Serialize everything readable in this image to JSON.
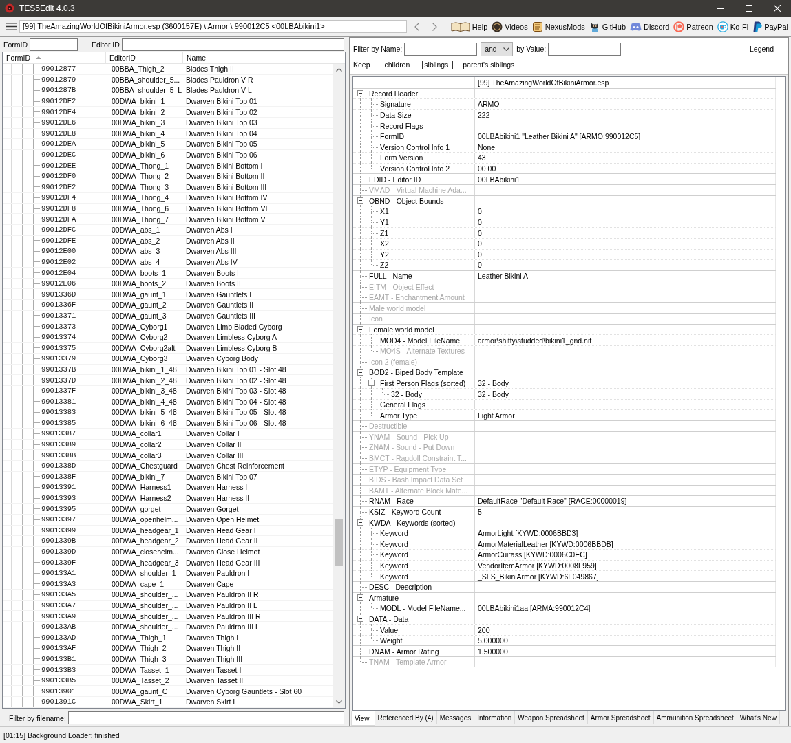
{
  "window": {
    "title": "TES5Edit 4.0.3"
  },
  "toolbar": {
    "path": "[99] TheAmazingWorldOfBikiniArmor.esp (3600157E) \\ Armor \\ 990012C5 <00LBAbikini1>",
    "links": [
      {
        "label": "Help",
        "kind": "help"
      },
      {
        "label": "Videos",
        "kind": "videos"
      },
      {
        "label": "NexusMods",
        "kind": "nexusmods"
      },
      {
        "label": "GitHub",
        "kind": "github"
      },
      {
        "label": "Discord",
        "kind": "discord"
      },
      {
        "label": "Patreon",
        "kind": "patreon"
      },
      {
        "label": "Ko-Fi",
        "kind": "kofi"
      },
      {
        "label": "PayPal",
        "kind": "paypal"
      }
    ]
  },
  "left_panel": {
    "formid_label": "FormID",
    "editorid_label": "Editor ID",
    "table": {
      "columns": [
        {
          "label": "FormID",
          "sorted": true
        },
        {
          "label": "EditorID",
          "sorted": false
        },
        {
          "label": "Name",
          "sorted": false
        }
      ],
      "rows": [
        {
          "form_id": "99012877",
          "editor_id": "00BBA_Thigh_2",
          "name": "Blades Thigh II"
        },
        {
          "form_id": "99012879",
          "editor_id": "00BBA_shoulder_5...",
          "name": "Blades Pauldron V R"
        },
        {
          "form_id": "9901287B",
          "editor_id": "00BBA_shoulder_5_L",
          "name": "Blades Pauldron V L"
        },
        {
          "form_id": "99012DE2",
          "editor_id": "00DWA_bikini_1",
          "name": "Dwarven Bikini Top 01"
        },
        {
          "form_id": "99012DE4",
          "editor_id": "00DWA_bikini_2",
          "name": "Dwarven Bikini Top 02"
        },
        {
          "form_id": "99012DE6",
          "editor_id": "00DWA_bikini_3",
          "name": "Dwarven Bikini Top 03"
        },
        {
          "form_id": "99012DE8",
          "editor_id": "00DWA_bikini_4",
          "name": "Dwarven Bikini Top 04"
        },
        {
          "form_id": "99012DEA",
          "editor_id": "00DWA_bikini_5",
          "name": "Dwarven Bikini Top 05"
        },
        {
          "form_id": "99012DEC",
          "editor_id": "00DWA_bikini_6",
          "name": "Dwarven Bikini Top 06"
        },
        {
          "form_id": "99012DEE",
          "editor_id": "00DWA_Thong_1",
          "name": "Dwarven Bikini Bottom I"
        },
        {
          "form_id": "99012DF0",
          "editor_id": "00DWA_Thong_2",
          "name": "Dwarven Bikini Bottom II"
        },
        {
          "form_id": "99012DF2",
          "editor_id": "00DWA_Thong_3",
          "name": "Dwarven Bikini Bottom III"
        },
        {
          "form_id": "99012DF4",
          "editor_id": "00DWA_Thong_4",
          "name": "Dwarven Bikini Bottom IV"
        },
        {
          "form_id": "99012DF8",
          "editor_id": "00DWA_Thong_6",
          "name": "Dwarven Bikini Bottom VI"
        },
        {
          "form_id": "99012DFA",
          "editor_id": "00DWA_Thong_7",
          "name": "Dwarven Bikini Bottom V"
        },
        {
          "form_id": "99012DFC",
          "editor_id": "00DWA_abs_1",
          "name": "Dwarven Abs I"
        },
        {
          "form_id": "99012DFE",
          "editor_id": "00DWA_abs_2",
          "name": "Dwarven Abs II"
        },
        {
          "form_id": "99012E00",
          "editor_id": "00DWA_abs_3",
          "name": "Dwarven Abs III"
        },
        {
          "form_id": "99012E02",
          "editor_id": "00DWA_abs_4",
          "name": "Dwarven Abs IV"
        },
        {
          "form_id": "99012E04",
          "editor_id": "00DWA_boots_1",
          "name": "Dwarven Boots I"
        },
        {
          "form_id": "99012E06",
          "editor_id": "00DWA_boots_2",
          "name": "Dwarven Boots II"
        },
        {
          "form_id": "9901336D",
          "editor_id": "00DWA_gaunt_1",
          "name": "Dwarven Gauntlets I"
        },
        {
          "form_id": "9901336F",
          "editor_id": "00DWA_gaunt_2",
          "name": "Dwarven Gauntlets II"
        },
        {
          "form_id": "99013371",
          "editor_id": "00DWA_gaunt_3",
          "name": "Dwarven Gauntlets III"
        },
        {
          "form_id": "99013373",
          "editor_id": "00DWA_Cyborg1",
          "name": "Dwarven Limb Bladed Cyborg"
        },
        {
          "form_id": "99013374",
          "editor_id": "00DWA_Cyborg2",
          "name": "Dwarven Limbless Cyborg A"
        },
        {
          "form_id": "99013375",
          "editor_id": "00DWA_Cyborg2alt",
          "name": "Dwarven Limbless Cyborg B"
        },
        {
          "form_id": "99013379",
          "editor_id": "00DWA_Cyborg3",
          "name": "Dwarven Cyborg Body"
        },
        {
          "form_id": "9901337B",
          "editor_id": "00DWA_bikini_1_48",
          "name": "Dwarven Bikini Top 01 - Slot 48"
        },
        {
          "form_id": "9901337D",
          "editor_id": "00DWA_bikini_2_48",
          "name": "Dwarven Bikini Top 02 - Slot 48"
        },
        {
          "form_id": "9901337F",
          "editor_id": "00DWA_bikini_3_48",
          "name": "Dwarven Bikini Top 03 - Slot 48"
        },
        {
          "form_id": "99013381",
          "editor_id": "00DWA_bikini_4_48",
          "name": "Dwarven Bikini Top 04 - Slot 48"
        },
        {
          "form_id": "99013383",
          "editor_id": "00DWA_bikini_5_48",
          "name": "Dwarven Bikini Top 05 - Slot 48"
        },
        {
          "form_id": "99013385",
          "editor_id": "00DWA_bikini_6_48",
          "name": "Dwarven Bikini Top 06 - Slot 48"
        },
        {
          "form_id": "99013387",
          "editor_id": "00DWA_collar1",
          "name": "Dwarven Collar I"
        },
        {
          "form_id": "99013389",
          "editor_id": "00DWA_collar2",
          "name": "Dwarven Collar II"
        },
        {
          "form_id": "9901338B",
          "editor_id": "00DWA_collar3",
          "name": "Dwarven Collar III"
        },
        {
          "form_id": "9901338D",
          "editor_id": "00DWA_Chestguard",
          "name": "Dwarven Chest Reinforcement"
        },
        {
          "form_id": "9901338F",
          "editor_id": "00DWA_bikini_7",
          "name": "Dwarven Bikini Top 07"
        },
        {
          "form_id": "99013391",
          "editor_id": "00DWA_Harness1",
          "name": "Dwarven Harness I"
        },
        {
          "form_id": "99013393",
          "editor_id": "00DWA_Harness2",
          "name": "Dwarven Harness II"
        },
        {
          "form_id": "99013395",
          "editor_id": "00DWA_gorget",
          "name": "Dwarven Gorget"
        },
        {
          "form_id": "99013397",
          "editor_id": "00DWA_openhelm...",
          "name": "Dwarven Open Helmet"
        },
        {
          "form_id": "99013399",
          "editor_id": "00DWA_headgear_1",
          "name": "Dwarven Head Gear I"
        },
        {
          "form_id": "9901339B",
          "editor_id": "00DWA_headgear_2",
          "name": "Dwarven Head Gear II"
        },
        {
          "form_id": "9901339D",
          "editor_id": "00DWA_closehelm...",
          "name": "Dwarven Close Helmet"
        },
        {
          "form_id": "9901339F",
          "editor_id": "00DWA_headgear_3",
          "name": "Dwarven Head Gear III"
        },
        {
          "form_id": "990133A1",
          "editor_id": "00DWA_shoulder_1",
          "name": "Dwarven Pauldron I"
        },
        {
          "form_id": "990133A3",
          "editor_id": "00DWA_cape_1",
          "name": "Dwarven Cape"
        },
        {
          "form_id": "990133A5",
          "editor_id": "00DWA_shoulder_...",
          "name": "Dwarven Pauldron II R"
        },
        {
          "form_id": "990133A7",
          "editor_id": "00DWA_shoulder_...",
          "name": "Dwarven Pauldron II L"
        },
        {
          "form_id": "990133A9",
          "editor_id": "00DWA_shoulder_...",
          "name": "Dwarven Pauldron III R"
        },
        {
          "form_id": "990133AB",
          "editor_id": "00DWA_shoulder_...",
          "name": "Dwarven Pauldron III L"
        },
        {
          "form_id": "990133AD",
          "editor_id": "00DWA_Thigh_1",
          "name": "Dwarven Thigh I"
        },
        {
          "form_id": "990133AF",
          "editor_id": "00DWA_Thigh_2",
          "name": "Dwarven Thigh II"
        },
        {
          "form_id": "990133B1",
          "editor_id": "00DWA_Thigh_3",
          "name": "Dwarven Thigh III"
        },
        {
          "form_id": "990133B3",
          "editor_id": "00DWA_Tasset_1",
          "name": "Dwarven Tasset I"
        },
        {
          "form_id": "990133B5",
          "editor_id": "00DWA_Tasset_2",
          "name": "Dwarven Tasset II"
        },
        {
          "form_id": "99013901",
          "editor_id": "00DWA_gaunt_C",
          "name": "Dwarven Cyborg Gauntlets - Slot 60"
        },
        {
          "form_id": "9901391C",
          "editor_id": "00DWA_Skirt_1",
          "name": "Dwarven Skirt I"
        }
      ]
    },
    "filename_label": "Filter by filename:"
  },
  "right_panel": {
    "filter": {
      "name_label": "Filter by Name:",
      "operator": "and",
      "value_label": "by Value:",
      "legend": "Legend"
    },
    "keep": {
      "label": "Keep",
      "options": [
        {
          "label": "children",
          "checked": false
        },
        {
          "label": "siblings",
          "checked": false
        },
        {
          "label": "parent's siblings",
          "checked": false
        }
      ]
    },
    "record_view": {
      "file_column": "[99] TheAmazingWorldOfBikiniArmor.esp",
      "fields": [
        {
          "label": "Record Header",
          "disabled": false,
          "expanded": true,
          "children": [
            {
              "label": "Signature",
              "value": "ARMO",
              "disabled": false
            },
            {
              "label": "Data Size",
              "value": "222",
              "disabled": false
            },
            {
              "label": "Record Flags",
              "disabled": false
            },
            {
              "label": "FormID",
              "value": "00LBAbikini1 \"Leather Bikini A\" [ARMO:990012C5]",
              "disabled": false
            },
            {
              "label": "Version Control Info 1",
              "value": "None",
              "disabled": false
            },
            {
              "label": "Form Version",
              "value": "43",
              "disabled": false
            },
            {
              "label": "Version Control Info 2",
              "value": "00 00",
              "disabled": false
            }
          ]
        },
        {
          "label": "EDID - Editor ID",
          "value": "00LBAbikini1",
          "disabled": false
        },
        {
          "label": "VMAD - Virtual Machine Ada...",
          "disabled": true
        },
        {
          "label": "OBND - Object Bounds",
          "disabled": false,
          "expanded": true,
          "children": [
            {
              "label": "X1",
              "value": "0",
              "disabled": false
            },
            {
              "label": "Y1",
              "value": "0",
              "disabled": false
            },
            {
              "label": "Z1",
              "value": "0",
              "disabled": false
            },
            {
              "label": "X2",
              "value": "0",
              "disabled": false
            },
            {
              "label": "Y2",
              "value": "0",
              "disabled": false
            },
            {
              "label": "Z2",
              "value": "0",
              "disabled": false
            }
          ]
        },
        {
          "label": "FULL - Name",
          "value": "Leather Bikini A",
          "disabled": false
        },
        {
          "label": "EITM - Object Effect",
          "disabled": true
        },
        {
          "label": "EAMT - Enchantment Amount",
          "disabled": true
        },
        {
          "label": "Male world model",
          "disabled": true
        },
        {
          "label": "Icon",
          "disabled": true
        },
        {
          "label": "Female world model",
          "disabled": false,
          "expanded": true,
          "children": [
            {
              "label": "MOD4 - Model FileName",
              "value": "armor\\shitty\\studded\\bikini1_gnd.nif",
              "disabled": false
            },
            {
              "label": "MO4S - Alternate Textures",
              "disabled": true
            }
          ]
        },
        {
          "label": "Icon 2 (female)",
          "disabled": true
        },
        {
          "label": "BOD2 - Biped Body Template",
          "disabled": false,
          "expanded": true,
          "children": [
            {
              "label": "First Person Flags (sorted)",
              "value": "32 - Body",
              "disabled": false,
              "expanded": true,
              "children": [
                {
                  "label": "32 - Body",
                  "value": "32 - Body",
                  "disabled": false
                }
              ]
            },
            {
              "label": "General Flags",
              "disabled": false
            },
            {
              "label": "Armor Type",
              "value": "Light Armor",
              "disabled": false
            }
          ]
        },
        {
          "label": "Destructible",
          "disabled": true
        },
        {
          "label": "YNAM - Sound - Pick Up",
          "disabled": true
        },
        {
          "label": "ZNAM - Sound - Put Down",
          "disabled": true
        },
        {
          "label": "BMCT - Ragdoll Constraint T...",
          "disabled": true
        },
        {
          "label": "ETYP - Equipment Type",
          "disabled": true
        },
        {
          "label": "BIDS - Bash Impact Data Set",
          "disabled": true
        },
        {
          "label": "BAMT - Alternate Block Mate...",
          "disabled": true
        },
        {
          "label": "RNAM - Race",
          "value": "DefaultRace \"Default Race\" [RACE:00000019]",
          "disabled": false
        },
        {
          "label": "KSIZ - Keyword Count",
          "value": "5",
          "disabled": false
        },
        {
          "label": "KWDA - Keywords (sorted)",
          "disabled": false,
          "expanded": true,
          "children": [
            {
              "label": "Keyword",
              "value": "ArmorLight [KYWD:0006BBD3]",
              "disabled": false
            },
            {
              "label": "Keyword",
              "value": "ArmorMaterialLeather [KYWD:0006BBDB]",
              "disabled": false
            },
            {
              "label": "Keyword",
              "value": "ArmorCuirass [KYWD:0006C0EC]",
              "disabled": false
            },
            {
              "label": "Keyword",
              "value": "VendorItemArmor [KYWD:0008F959]",
              "disabled": false
            },
            {
              "label": "Keyword",
              "value": "_SLS_BikiniArmor [KYWD:6F049867]",
              "disabled": false
            }
          ]
        },
        {
          "label": "DESC - Description",
          "disabled": false
        },
        {
          "label": "Armature",
          "disabled": false,
          "expanded": true,
          "children": [
            {
              "label": "MODL - Model FileName...",
              "value": "00LBAbikini1aa [ARMA:990012C4]",
              "disabled": false
            }
          ]
        },
        {
          "label": "DATA - Data",
          "disabled": false,
          "expanded": true,
          "children": [
            {
              "label": "Value",
              "value": "200",
              "disabled": false
            },
            {
              "label": "Weight",
              "value": "5.000000",
              "disabled": false
            }
          ]
        },
        {
          "label": "DNAM - Armor Rating",
          "value": "1.500000",
          "disabled": false
        },
        {
          "label": "TNAM - Template Armor",
          "disabled": true
        }
      ]
    },
    "tabs": [
      {
        "label": "View",
        "selected": true
      },
      {
        "label": "Referenced By (4)",
        "selected": false
      },
      {
        "label": "Messages",
        "selected": false
      },
      {
        "label": "Information",
        "selected": false
      },
      {
        "label": "Weapon Spreadsheet",
        "selected": false
      },
      {
        "label": "Armor Spreadsheet",
        "selected": false
      },
      {
        "label": "Ammunition Spreadsheet",
        "selected": false
      },
      {
        "label": "What's New",
        "selected": false
      }
    ]
  },
  "status_bar": {
    "text": "[01:15] Background Loader: finished"
  }
}
